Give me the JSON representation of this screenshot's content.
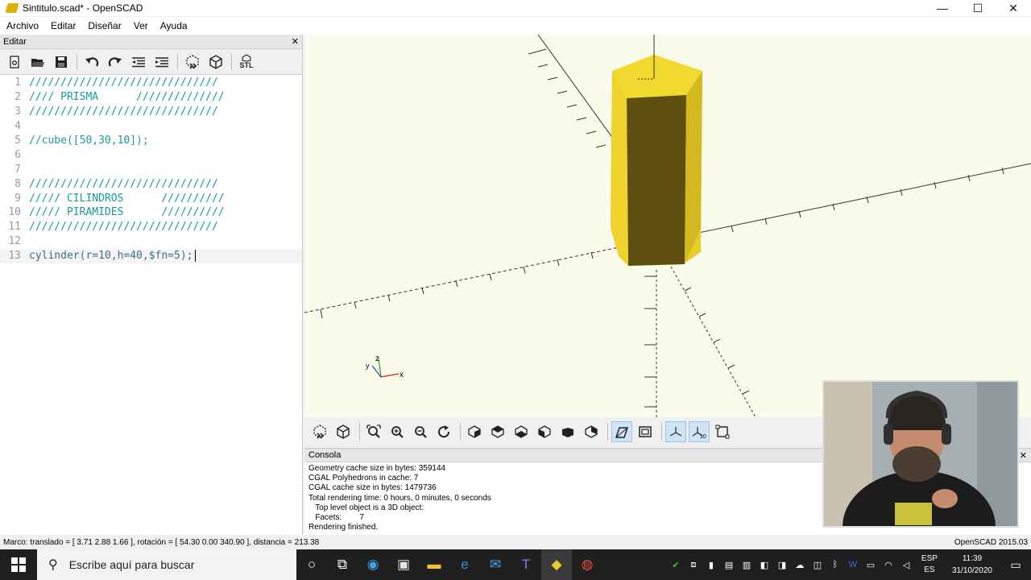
{
  "window": {
    "title": "Sintitulo.scad* - OpenSCAD",
    "controls": {
      "minimize": "—",
      "maximize": "☐",
      "close": "✕"
    }
  },
  "menu": [
    "Archivo",
    "Editar",
    "Diseñar",
    "Ver",
    "Ayuda"
  ],
  "editor": {
    "header": "Editar",
    "close": "✕",
    "toolbar_icons": [
      "new-file-icon",
      "open-file-icon",
      "save-icon",
      "undo-icon",
      "redo-icon",
      "unindent-icon",
      "indent-icon",
      "preview-icon",
      "render-icon",
      "export-stl-icon"
    ],
    "stl_label": "STL",
    "lines": [
      {
        "n": "1",
        "text": "//////////////////////////////"
      },
      {
        "n": "2",
        "text": "//// PRISMA      //////////////"
      },
      {
        "n": "3",
        "text": "//////////////////////////////"
      },
      {
        "n": "4",
        "text": ""
      },
      {
        "n": "5",
        "text": "//cube([50,30,10]);"
      },
      {
        "n": "6",
        "text": ""
      },
      {
        "n": "7",
        "text": ""
      },
      {
        "n": "8",
        "text": "//////////////////////////////"
      },
      {
        "n": "9",
        "text": "///// CILINDROS      //////////"
      },
      {
        "n": "10",
        "text": "///// PIRAMIDES      //////////"
      },
      {
        "n": "11",
        "text": "//////////////////////////////"
      },
      {
        "n": "12",
        "text": ""
      },
      {
        "n": "13",
        "text": "cylinder(r=10,h=40,$fn=5);"
      }
    ]
  },
  "viewport": {
    "axis_labels": {
      "z": "z",
      "y": "y",
      "x": "x"
    },
    "model_colors": {
      "light": "#f2d930",
      "dark": "#5c4f10",
      "side": "#e8cc2a"
    }
  },
  "view_toolbar": [
    "preview-icon",
    "render-icon",
    "view-all-icon",
    "zoom-in-icon",
    "zoom-out-icon",
    "reset-view-icon",
    "right-view-icon",
    "top-view-icon",
    "bottom-view-icon",
    "left-view-icon",
    "front-view-icon",
    "back-view-icon",
    "perspective-icon",
    "orthogonal-icon",
    "show-axes-icon",
    "show-scale-markers-icon",
    "show-edges-icon"
  ],
  "console": {
    "header": "Consola",
    "close": "✕",
    "lines": [
      "Geometry cache size in bytes: 359144",
      "CGAL Polyhedrons in cache: 7",
      "CGAL cache size in bytes: 1479736",
      "Total rendering time: 0 hours, 0 minutes, 0 seconds",
      "   Top level object is a 3D object:",
      "   Facets:        7",
      "Rendering finished."
    ]
  },
  "statusbar": {
    "left": "Marco: translado = [ 3.71 2.88 1.66 ], rotación = [ 54.30 0.00 340.90 ], distancia = 213.38",
    "right": "OpenSCAD 2015.03"
  },
  "taskbar": {
    "search_placeholder": "Escribe aquí para buscar",
    "lang_top": "ESP",
    "lang_bottom": "ES",
    "time": "11:39",
    "date": "31/10/2020"
  }
}
